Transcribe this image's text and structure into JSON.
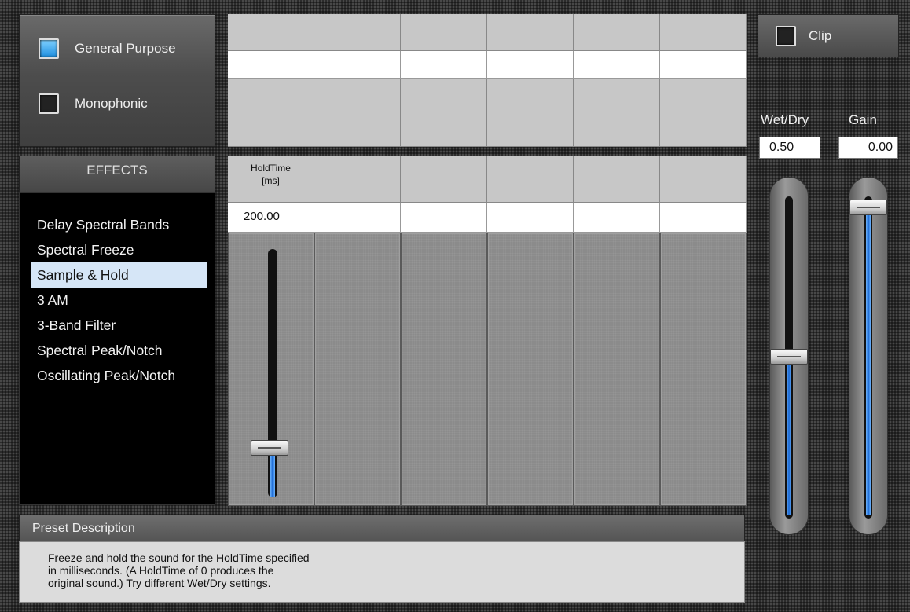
{
  "mode": {
    "options": [
      {
        "label": "General Purpose",
        "selected": true
      },
      {
        "label": "Monophonic",
        "selected": false
      }
    ]
  },
  "effects": {
    "header": "EFFECTS",
    "items": [
      "Delay Spectral Bands",
      "Spectral Freeze",
      "Sample & Hold",
      "3 AM",
      "3-Band Filter",
      "Spectral Peak/Notch",
      "Oscillating Peak/Notch"
    ],
    "selected_index": 2
  },
  "params": {
    "hold_time": {
      "name_line1": "HoldTime",
      "name_line2": "[ms]",
      "value": "200.00",
      "level": 0.2
    }
  },
  "preset": {
    "header": "Preset Description",
    "line1": "Freeze and hold the sound for the HoldTime specified",
    "line2": "in milliseconds. (A HoldTime of 0 produces the",
    "line3": "original sound.) Try different Wet/Dry settings."
  },
  "clip": {
    "label": "Clip",
    "on": false
  },
  "wetdry": {
    "label": "Wet/Dry",
    "value": "0.50",
    "level": 0.5
  },
  "gain": {
    "label": "Gain",
    "value": "0.00",
    "level": 0.97
  },
  "colors": {
    "accent_blue": "#1e8fe0",
    "selection_bg": "#d6e6f7"
  }
}
